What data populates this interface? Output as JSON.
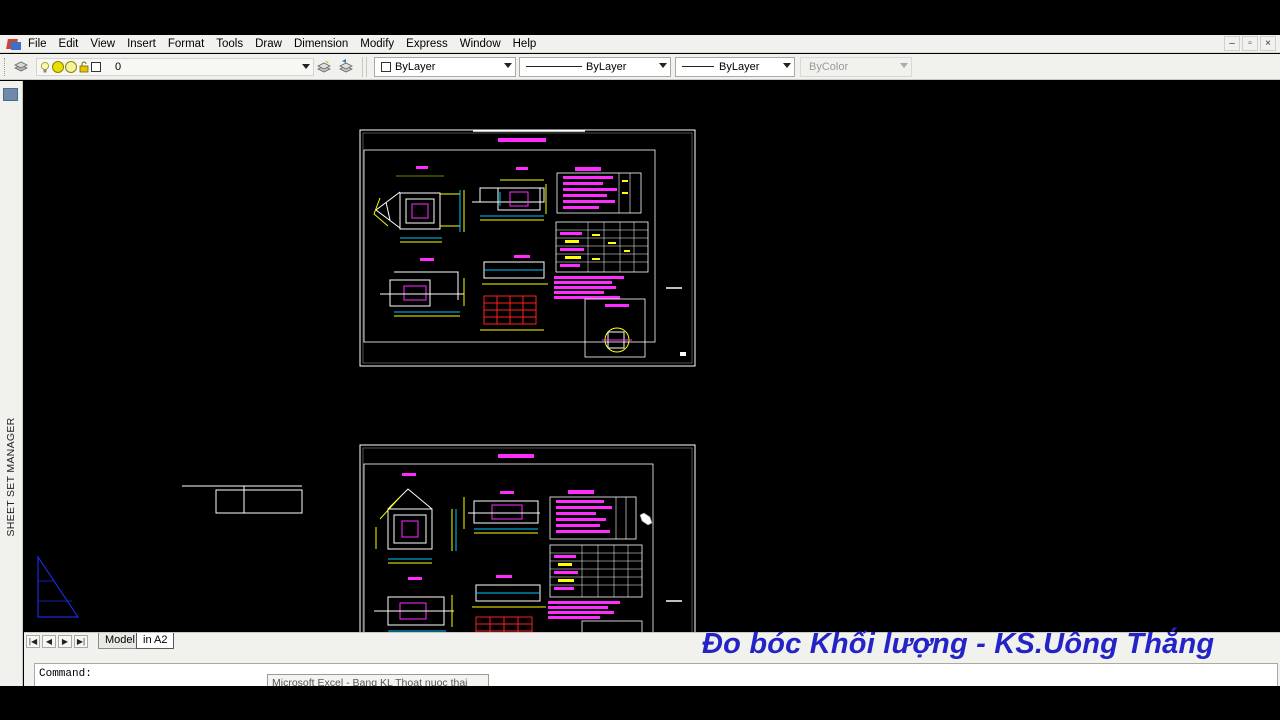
{
  "menu": {
    "items": [
      "File",
      "Edit",
      "View",
      "Insert",
      "Format",
      "Tools",
      "Draw",
      "Dimension",
      "Modify",
      "Express",
      "Window",
      "Help"
    ]
  },
  "window_controls": {
    "minimize": "–",
    "restore": "▫",
    "close": "×"
  },
  "layer_toolbar": {
    "current_layer": "0",
    "color": "ByLayer",
    "linetype": "ByLayer",
    "lineweight": "ByLayer",
    "plot_style": "ByColor"
  },
  "palette": {
    "sheet_set_label": "SHEET SET MANAGER"
  },
  "layout_tabs": {
    "nav": [
      "|◀",
      "◀",
      "▶",
      "▶|"
    ],
    "tabs": [
      "Model",
      "in A2"
    ],
    "active": "in A2"
  },
  "drawing": {
    "sheet_1_title": "CỬA XẢ QUA ĐƯỜNG DẠNG B",
    "sheet_2_title": "CỬA XẢ QUA ĐƯỜNG DẠNG B",
    "colors": {
      "white": "#ffffff",
      "yellow": "#ffff00",
      "magenta": "#ff2cff",
      "cyan": "#00c8ff",
      "red": "#ff2020",
      "blue": "#1a2ad8"
    }
  },
  "command_line": {
    "prompt": "Command:"
  },
  "taskbar_tooltip": "Microsoft Excel - Bang KL Thoat nuoc thai",
  "watermark": "Đo bóc Khối lượng - KS.Uông Thắng"
}
